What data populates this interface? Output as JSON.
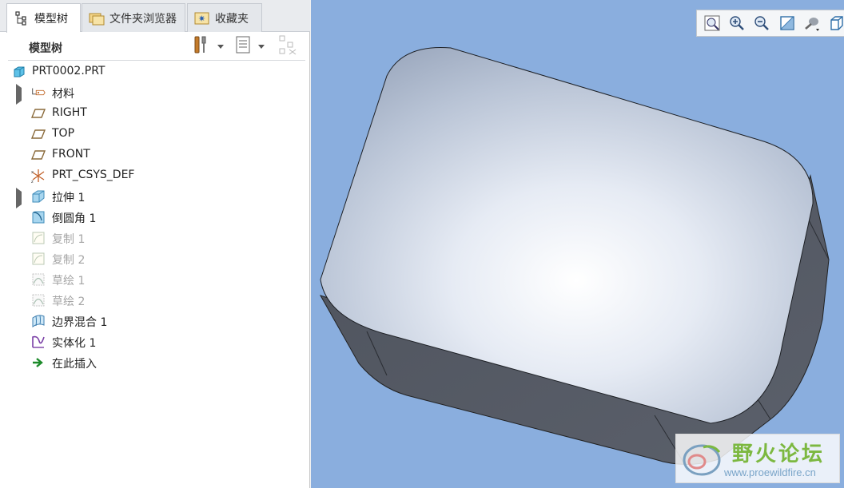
{
  "tabs": [
    {
      "label": "模型树"
    },
    {
      "label": "文件夹浏览器"
    },
    {
      "label": "收藏夹"
    }
  ],
  "tree_panel": {
    "title": "模型树"
  },
  "tree": [
    {
      "label": "PRT0002.PRT",
      "icon": "part-icon",
      "muted": false
    },
    {
      "label": "材料",
      "icon": "material-icon",
      "muted": false,
      "expandable": true
    },
    {
      "label": "RIGHT",
      "icon": "datum-plane-icon",
      "muted": false
    },
    {
      "label": "TOP",
      "icon": "datum-plane-icon",
      "muted": false
    },
    {
      "label": "FRONT",
      "icon": "datum-plane-icon",
      "muted": false
    },
    {
      "label": "PRT_CSYS_DEF",
      "icon": "csys-icon",
      "muted": false
    },
    {
      "label": "拉伸 1",
      "icon": "extrude-icon",
      "muted": false,
      "expandable": true
    },
    {
      "label": "倒圆角 1",
      "icon": "round-icon",
      "muted": false
    },
    {
      "label": "复制 1",
      "icon": "copy-icon",
      "muted": true
    },
    {
      "label": "复制 2",
      "icon": "copy-icon",
      "muted": true
    },
    {
      "label": "草绘 1",
      "icon": "sketch-icon",
      "muted": true
    },
    {
      "label": "草绘 2",
      "icon": "sketch-icon",
      "muted": true
    },
    {
      "label": "边界混合 1",
      "icon": "boundary-blend-icon",
      "muted": false
    },
    {
      "label": "实体化 1",
      "icon": "solidify-icon",
      "muted": false
    },
    {
      "label": "在此插入",
      "icon": "insert-arrow-icon",
      "muted": false
    }
  ],
  "view_toolbar": [
    "refit-icon",
    "zoom-in-icon",
    "zoom-out-icon",
    "repaint-icon",
    "display-style-icon",
    "saved-views-icon"
  ],
  "watermark": {
    "title": "野火论坛",
    "url": "www.proewildfire.cn"
  },
  "colors": {
    "viewport_bg": "#8aaede",
    "model_top": "#c9d2e0",
    "model_side": "#565b66"
  }
}
